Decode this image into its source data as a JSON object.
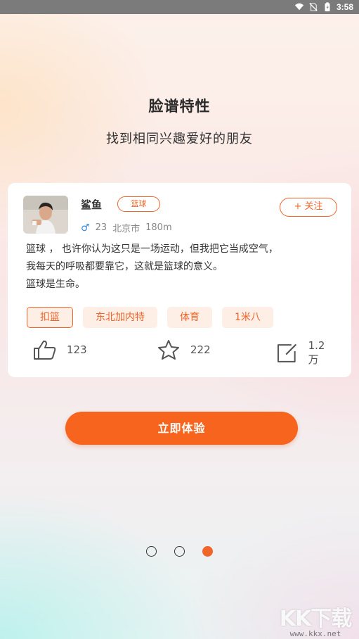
{
  "status_bar": {
    "time": "3:58"
  },
  "page": {
    "title": "脸谱特性",
    "subtitle": "找到相同兴趣爱好的朋友"
  },
  "card": {
    "user": {
      "name": "鲨鱼",
      "badge": "篮球",
      "gender_icon": "♂",
      "age": "23",
      "city": "北京市",
      "distance": "180m"
    },
    "follow_label": "+ 关注",
    "post_lines": [
      "篮球 ， 也许你认为这只是一场运动，但我把它当成空气，",
      "我每天的呼吸都要靠它，这就是篮球的意义。",
      "篮球是生命。"
    ],
    "tags": [
      "扣篮",
      "东北加内特",
      "体育",
      "1米八"
    ],
    "actions": {
      "likes": "123",
      "favorites": "222",
      "comments": "1.2万"
    }
  },
  "cta": {
    "label": "立即体验"
  },
  "pager": {
    "count": 3,
    "active_index": 2
  },
  "watermark": {
    "logo": "KK下载",
    "site": "www.kkx.net"
  },
  "colors": {
    "accent": "#f0652a",
    "cta": "#f7641d",
    "status_bar": "#7b7b7b"
  }
}
